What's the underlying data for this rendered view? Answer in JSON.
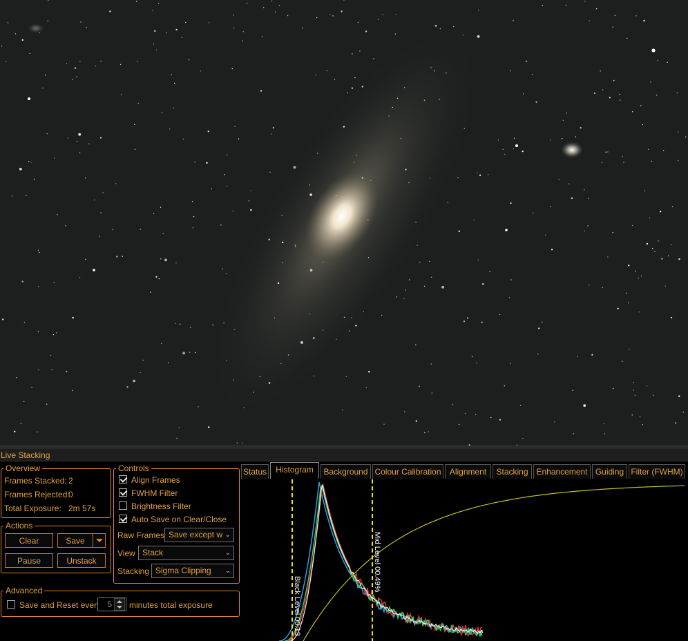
{
  "panel_title": "Live Stacking",
  "overview": {
    "legend": "Overview",
    "frames_stacked_label": "Frames Stacked:",
    "frames_stacked_value": "2",
    "frames_rejected_label": "Frames Rejected:",
    "frames_rejected_value": "0",
    "total_exposure_label": "Total Exposure:",
    "total_exposure_value": "2m 57s"
  },
  "actions": {
    "legend": "Actions",
    "clear": "Clear",
    "save": "Save",
    "pause": "Pause",
    "unstack": "Unstack"
  },
  "controls": {
    "legend": "Controls",
    "align_frames": {
      "label": "Align Frames",
      "checked": true
    },
    "fwhm_filter": {
      "label": "FWHM Filter",
      "checked": true
    },
    "brightness_filter": {
      "label": "Brightness Filter",
      "checked": false
    },
    "auto_save": {
      "label": "Auto Save on Clear/Close",
      "checked": true
    },
    "raw_frames_label": "Raw Frames",
    "raw_frames_value": "Save except w",
    "view_label": "View",
    "view_value": "Stack",
    "stacking_label": "Stacking",
    "stacking_value": "Sigma Clipping"
  },
  "advanced": {
    "legend": "Advanced",
    "save_reset_label": "Save and Reset every",
    "save_reset_checked": false,
    "minutes_value": "5",
    "minutes_suffix": "minutes total exposure"
  },
  "tabs": [
    "Status",
    "Histogram",
    "Background",
    "Colour Calibration",
    "Alignment",
    "Stacking",
    "Enhancement",
    "Guiding",
    "Filter (FWHM)"
  ],
  "active_tab": "Histogram",
  "histogram": {
    "black_level_label": "Black Level 00.13",
    "mid_level_label": "Mid Level 00.49%",
    "marker_color": "#f0e020",
    "curve_color": "#c8c020"
  },
  "icons": {
    "save_dropdown": "chevron-down-icon",
    "select_dropdown": "chevron-down-icon",
    "spinner": "spinner-arrows-icon"
  }
}
